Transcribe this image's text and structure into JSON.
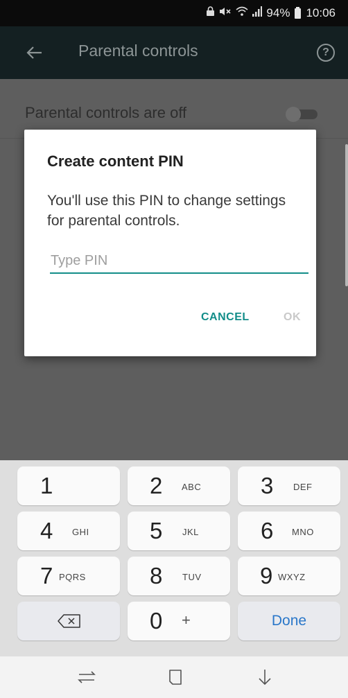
{
  "status_bar": {
    "battery": "94%",
    "time": "10:06",
    "icons": [
      "lock-icon",
      "mute-icon",
      "wifi-icon",
      "signal-icon",
      "battery-icon"
    ]
  },
  "toolbar": {
    "title": "Parental controls",
    "icons": [
      "back-arrow-icon",
      "help-icon"
    ]
  },
  "settings": {
    "parental_label": "Parental controls are off",
    "toggle_state": "off"
  },
  "dialog": {
    "title": "Create content PIN",
    "message": "You'll use this PIN to change settings for parental controls.",
    "pin_placeholder": "Type PIN",
    "pin_value": "",
    "cancel_label": "CANCEL",
    "ok_label": "OK"
  },
  "keyboard": {
    "keys": [
      {
        "digit": "1",
        "letters": ""
      },
      {
        "digit": "2",
        "letters": "ABC"
      },
      {
        "digit": "3",
        "letters": "DEF"
      },
      {
        "digit": "4",
        "letters": "GHI"
      },
      {
        "digit": "5",
        "letters": "JKL"
      },
      {
        "digit": "6",
        "letters": "MNO"
      },
      {
        "digit": "7",
        "letters": "PQRS"
      },
      {
        "digit": "8",
        "letters": "TUV"
      },
      {
        "digit": "9",
        "letters": "WXYZ"
      }
    ],
    "zero": {
      "digit": "0",
      "letters": "+"
    },
    "done_label": "Done"
  },
  "colors": {
    "accent": "#128d89",
    "done_blue": "#2a77c9",
    "scrim": "#5e5e5e"
  },
  "nav_bar": {
    "icons": [
      "recents-icon",
      "home-icon",
      "back-icon"
    ]
  }
}
